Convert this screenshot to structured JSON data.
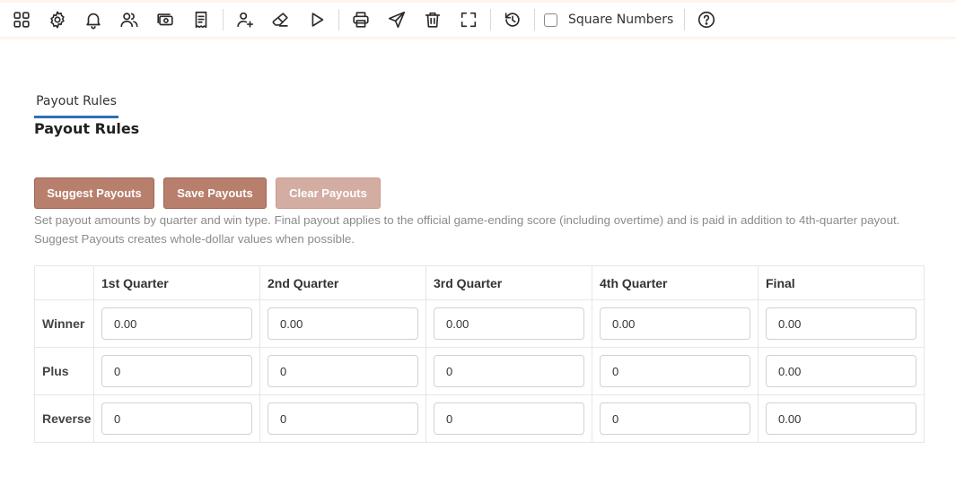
{
  "toolbar": {
    "items": [
      {
        "icon": "grid-icon"
      },
      {
        "icon": "gear-icon"
      },
      {
        "icon": "bell-icon"
      },
      {
        "icon": "users-icon"
      },
      {
        "icon": "cash-icon"
      },
      {
        "icon": "receipt-icon"
      },
      {
        "icon": "add-user-icon"
      },
      {
        "icon": "eraser-icon"
      },
      {
        "icon": "play-icon"
      },
      {
        "icon": "printer-icon"
      },
      {
        "icon": "send-icon"
      },
      {
        "icon": "trash-icon"
      },
      {
        "icon": "fullscreen-icon"
      },
      {
        "icon": "history-icon"
      },
      {
        "icon": "help-circle-icon"
      }
    ],
    "square_numbers_label": "Square Numbers",
    "square_numbers_checked": false
  },
  "tabs": [
    {
      "label": "Payout Rules",
      "active": true
    }
  ],
  "page_title": "Payout Rules",
  "buttons": {
    "suggest": "Suggest Payouts",
    "save": "Save Payouts",
    "clear": "Clear Payouts"
  },
  "help_text": "Set payout amounts by quarter and win type. Final payout applies to the official game-ending score (including overtime) and is paid in addition to 4th-quarter payout. Suggest Payouts creates whole-dollar values when possible.",
  "table": {
    "columns": [
      "",
      "1st Quarter",
      "2nd Quarter",
      "3rd Quarter",
      "4th Quarter",
      "Final"
    ],
    "rows": [
      {
        "label": "Winner",
        "values": [
          "0.00",
          "0.00",
          "0.00",
          "0.00",
          "0.00"
        ]
      },
      {
        "label": "Plus",
        "values": [
          "0",
          "0",
          "0",
          "0",
          "0.00"
        ]
      },
      {
        "label": "Reverse",
        "values": [
          "0",
          "0",
          "0",
          "0",
          "0.00"
        ]
      }
    ]
  },
  "colors": {
    "primary_button": "#b87f6d",
    "disabled_button": "#d3ada1",
    "tab_underline": "#2f6fb8",
    "toolbar_border": "#fdf5ee"
  }
}
